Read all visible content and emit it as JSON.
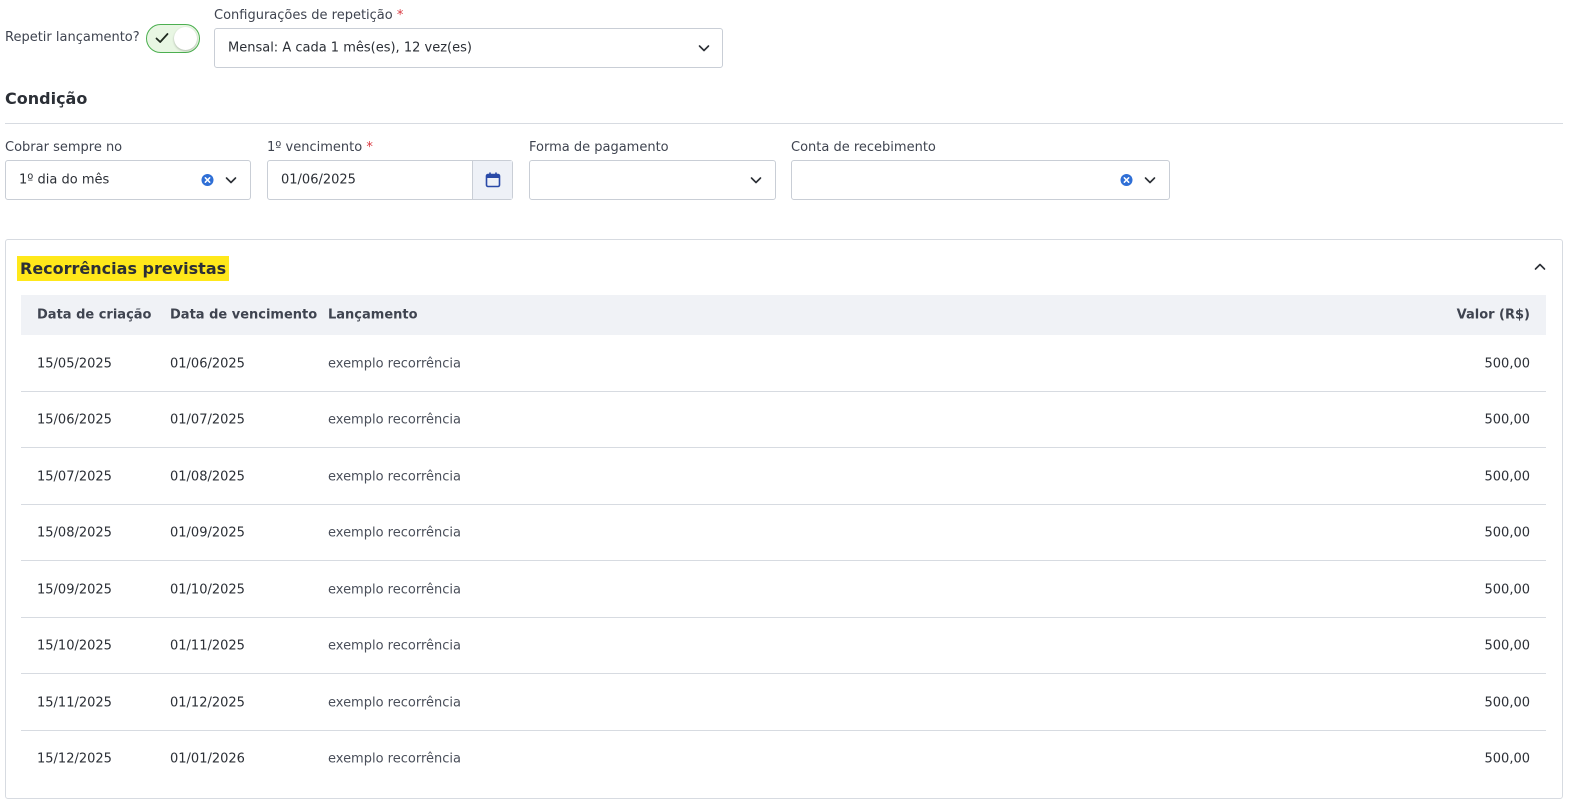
{
  "repeat": {
    "label": "Repetir lançamento?",
    "toggle_on": true
  },
  "repetition_config": {
    "label": "Configurações de repetição",
    "required_mark": "*",
    "value": "Mensal: A cada 1 mês(es), 12 vez(es)"
  },
  "condition": {
    "title": "Condição",
    "charge_day": {
      "label": "Cobrar sempre no",
      "value": "1º dia do mês"
    },
    "first_due": {
      "label": "1º vencimento",
      "required_mark": "*",
      "value": "01/06/2025"
    },
    "payment_method": {
      "label": "Forma de pagamento",
      "value": ""
    },
    "receiving_account": {
      "label": "Conta de recebimento",
      "value": ""
    }
  },
  "recurrences": {
    "title": "Recorrências previstas",
    "columns": [
      "Data de criação",
      "Data de vencimento",
      "Lançamento",
      "Valor (R$)"
    ],
    "rows": [
      [
        "15/05/2025",
        "01/06/2025",
        "exemplo recorrência",
        "500,00"
      ],
      [
        "15/06/2025",
        "01/07/2025",
        "exemplo recorrência",
        "500,00"
      ],
      [
        "15/07/2025",
        "01/08/2025",
        "exemplo recorrência",
        "500,00"
      ],
      [
        "15/08/2025",
        "01/09/2025",
        "exemplo recorrência",
        "500,00"
      ],
      [
        "15/09/2025",
        "01/10/2025",
        "exemplo recorrência",
        "500,00"
      ],
      [
        "15/10/2025",
        "01/11/2025",
        "exemplo recorrência",
        "500,00"
      ],
      [
        "15/11/2025",
        "01/12/2025",
        "exemplo recorrência",
        "500,00"
      ],
      [
        "15/12/2025",
        "01/01/2026",
        "exemplo recorrência",
        "500,00"
      ]
    ]
  },
  "colors": {
    "toggle_border": "#4caf50",
    "toggle_bg": "#e8f6e3",
    "highlight": "#ffe81a",
    "table_header_bg": "#f0f2f6",
    "clear_icon": "#2f6fd6",
    "required": "#d9363e"
  },
  "icons": {
    "toggle": "check-icon",
    "dropdown": "chevron-down-icon",
    "clear": "clear-circle-icon",
    "date": "calendar-icon",
    "collapse": "chevron-up-icon"
  }
}
